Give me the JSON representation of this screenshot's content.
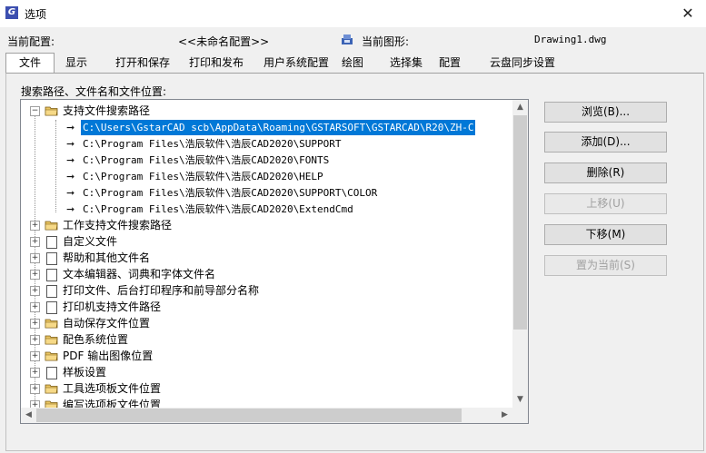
{
  "window": {
    "title": "选项",
    "close": "✕"
  },
  "config": {
    "current_config_label": "当前配置:",
    "current_config_value": "<<未命名配置>>",
    "current_drawing_label": "当前图形:",
    "current_drawing_value": "Drawing1.dwg"
  },
  "tabs": [
    {
      "label": "文件",
      "active": true
    },
    {
      "label": "显示"
    },
    {
      "label": "打开和保存"
    },
    {
      "label": "打印和发布"
    },
    {
      "label": "用户系统配置"
    },
    {
      "label": "绘图"
    },
    {
      "label": "选择集"
    },
    {
      "label": "配置"
    },
    {
      "label": "云盘同步设置"
    }
  ],
  "files_tab": {
    "section_label": "搜索路径、文件名和文件位置:",
    "tree": {
      "support_root": {
        "expander": "−",
        "label": "支持文件搜索路径"
      },
      "support_paths": [
        "C:\\Users\\GstarCAD scb\\AppData\\Roaming\\GSTARSOFT\\GSTARCAD\\R20\\ZH-C",
        "C:\\Program Files\\浩辰软件\\浩辰CAD2020\\SUPPORT",
        "C:\\Program Files\\浩辰软件\\浩辰CAD2020\\FONTS",
        "C:\\Program Files\\浩辰软件\\浩辰CAD2020\\HELP",
        "C:\\Program Files\\浩辰软件\\浩辰CAD2020\\SUPPORT\\COLOR",
        "C:\\Program Files\\浩辰软件\\浩辰CAD2020\\ExtendCmd"
      ],
      "nodes": [
        {
          "label": "工作支持文件搜索路径",
          "icon": "folder-icon"
        },
        {
          "label": "自定义文件",
          "icon": "document-icon"
        },
        {
          "label": "帮助和其他文件名",
          "icon": "document-icon"
        },
        {
          "label": "文本编辑器、词典和字体文件名",
          "icon": "document-icon"
        },
        {
          "label": "打印文件、后台打印程序和前导部分名称",
          "icon": "document-icon"
        },
        {
          "label": "打印机支持文件路径",
          "icon": "document-icon"
        },
        {
          "label": "自动保存文件位置",
          "icon": "folder-icon"
        },
        {
          "label": "配色系统位置",
          "icon": "folder-icon"
        },
        {
          "label": "PDF 输出图像位置",
          "icon": "folder-icon"
        },
        {
          "label": "样板设置",
          "icon": "document-icon"
        },
        {
          "label": "工具选项板文件位置",
          "icon": "folder-icon"
        },
        {
          "label": "编写选项板文件位置",
          "icon": "folder-icon"
        }
      ],
      "expander_collapsed": "+",
      "path_arrow": "➞"
    },
    "scroll": {
      "up": "▲",
      "down": "▼",
      "left": "◀",
      "right": "▶"
    },
    "buttons": {
      "browse": "浏览(B)...",
      "add": "添加(D)...",
      "remove": "删除(R)",
      "move_up": "上移(U)",
      "move_down": "下移(M)",
      "set_current": "置为当前(S)"
    }
  },
  "colors": {
    "selection": "#0078d7",
    "app_icon": "#3c4fb0"
  }
}
